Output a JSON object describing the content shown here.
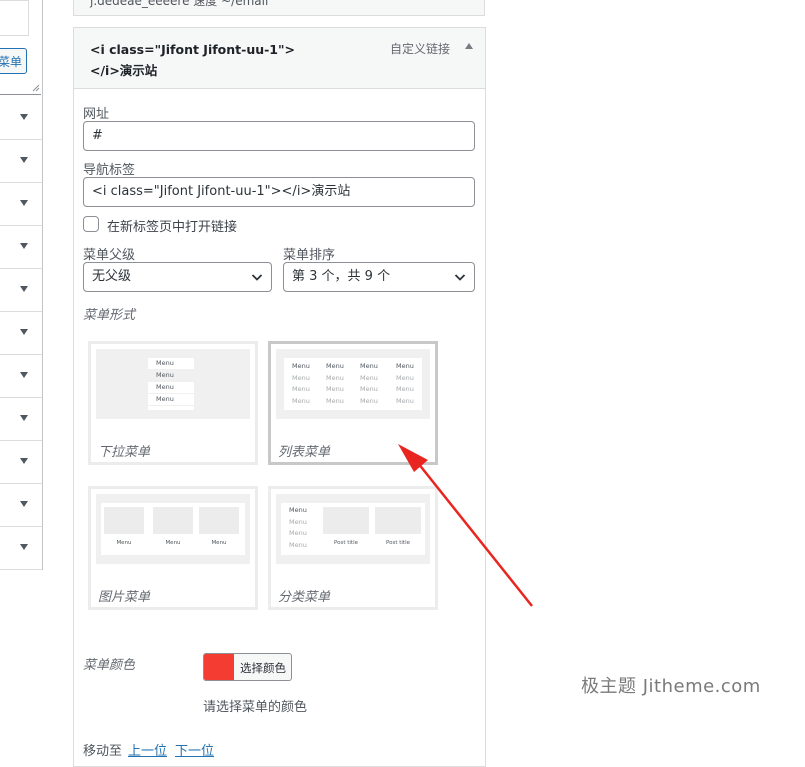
{
  "left_column": {
    "button_label": "菜单",
    "row_count": 11
  },
  "top_strip": {
    "text": "j.dedeae_eeeere  速度 ~/emaii"
  },
  "menu_item": {
    "title": "<i class=\"Jifont Jifont-uu-1\">\n</i>演示站",
    "type_label": "自定义链接",
    "url": {
      "label": "网址",
      "value": "#"
    },
    "nav_label": {
      "label": "导航标签",
      "value": "<i class=\"Jifont Jifont-uu-1\"></i>演示站"
    },
    "open_new_tab": {
      "label": "在新标签页中打开链接",
      "checked": false
    },
    "parent": {
      "label": "菜单父级",
      "value": "无父级"
    },
    "order": {
      "label": "菜单排序",
      "value": "第 3 个，共 9 个"
    },
    "style": {
      "label": "菜单形式",
      "selected": "list",
      "options": [
        {
          "id": "dropdown",
          "name": "下拉菜单",
          "preview_items": [
            "Menu",
            "Menu",
            "Menu",
            "Menu"
          ]
        },
        {
          "id": "list",
          "name": "列表菜单",
          "preview_header": "Menu",
          "preview_item": "Menu"
        },
        {
          "id": "image",
          "name": "图片菜单",
          "preview_caption": "Menu"
        },
        {
          "id": "category",
          "name": "分类菜单",
          "preview_items": [
            "Menu",
            "Menu",
            "Menu",
            "Menu"
          ],
          "preview_caption": "Post title"
        }
      ]
    },
    "color": {
      "label": "菜单颜色",
      "value": "#f53c32",
      "button_label": "选择颜色",
      "hint": "请选择菜单的颜色"
    },
    "move": {
      "label": "移动至",
      "up": "上一位",
      "down": "下一位"
    }
  },
  "watermark": "极主题 Jitheme.com",
  "colors": {
    "accent": "#2271b1",
    "arrow": "#e8251f"
  }
}
